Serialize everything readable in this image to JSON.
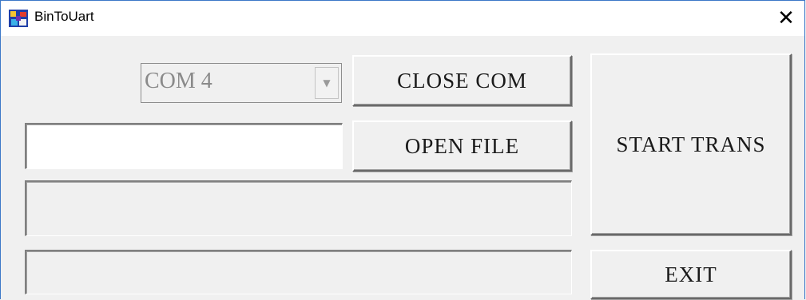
{
  "window": {
    "title": "BinToUart",
    "close_glyph": "✕",
    "app_icon": "app-logo-icon"
  },
  "port": {
    "selected": "COM 4",
    "enabled": false,
    "arrow_glyph": "▼"
  },
  "buttons": {
    "close_com": "CLOSE COM",
    "open_file": "OPEN FILE",
    "start_trans": "START TRANS",
    "exit": "EXIT"
  },
  "file": {
    "path_value": ""
  },
  "progress": {
    "bar1_fraction": 0,
    "bar2_fraction": 0
  },
  "colors": {
    "window_bg": "#f0f0f0",
    "title_bg": "#ffffff",
    "border_accent": "#3c78c8",
    "disabled_text": "#8a8a8a"
  }
}
